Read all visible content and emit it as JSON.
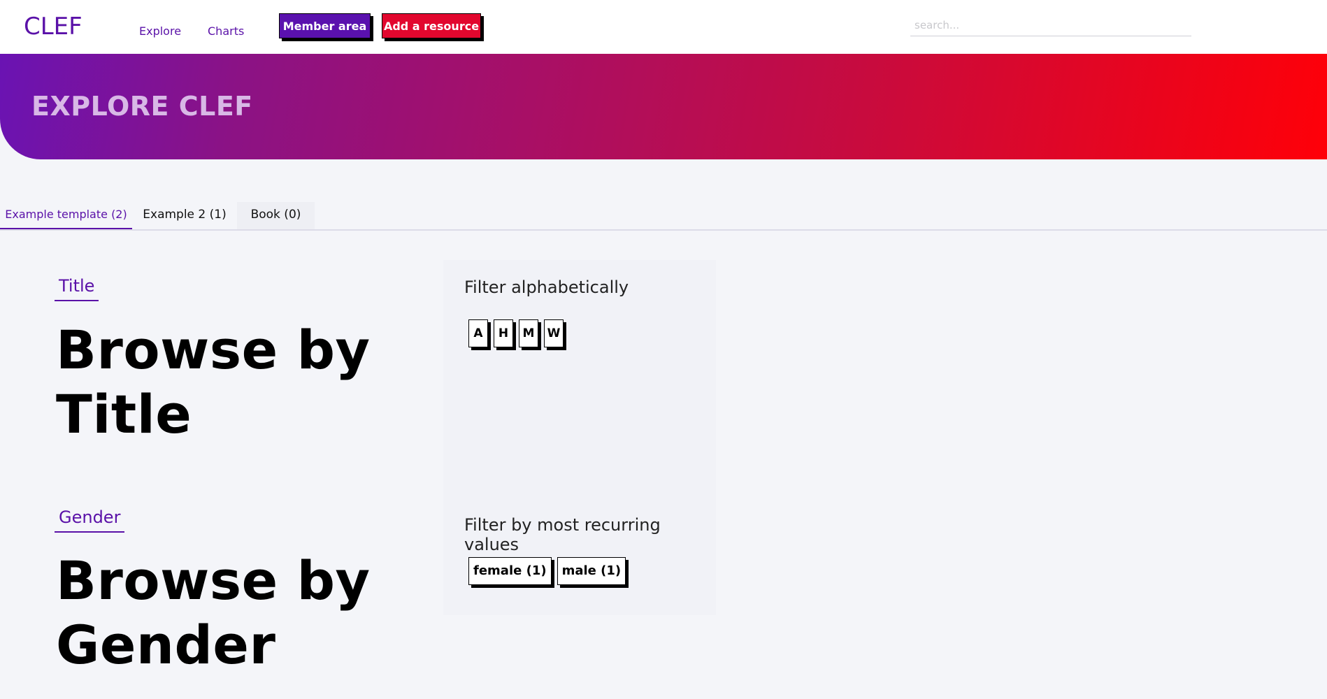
{
  "header": {
    "logo": "CLEF",
    "nav": [
      {
        "label": "Explore"
      },
      {
        "label": "Charts"
      }
    ],
    "member_button": "Member area",
    "add_button": "Add a resource",
    "search_placeholder": "search..."
  },
  "hero": {
    "title": "EXPLORE CLEF"
  },
  "tabs": [
    {
      "label": "Example template (2)",
      "active": true
    },
    {
      "label": "Example 2 (1)",
      "active": false
    },
    {
      "label": "Book (0)",
      "active": false
    }
  ],
  "sections": [
    {
      "label": "Title",
      "heading": "Browse by Title",
      "filter_title": "Filter alphabetically",
      "chips": [
        "A",
        "H",
        "M",
        "W"
      ]
    },
    {
      "label": "Gender",
      "heading": "Browse by Gender",
      "filter_title": "Filter by most recurring values",
      "chips": [
        "female (1)",
        "male (1)"
      ]
    }
  ]
}
